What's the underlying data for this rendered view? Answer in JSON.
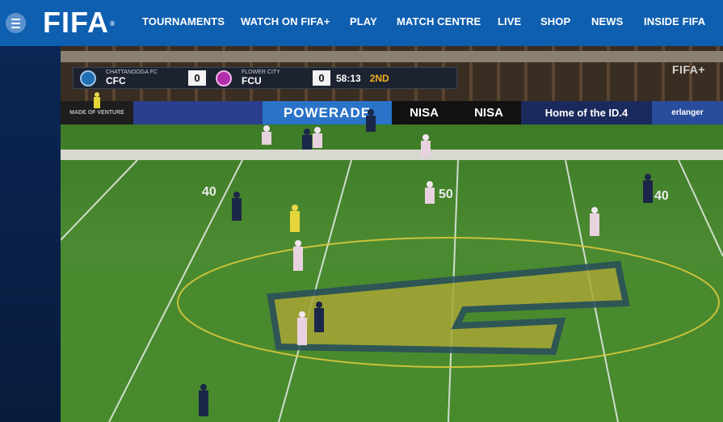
{
  "header": {
    "logo": "FIFA",
    "logo_mark": "®",
    "nav": [
      {
        "label": "TOURNAMENTS"
      },
      {
        "label": "WATCH ON FIFA+"
      },
      {
        "label": "PLAY"
      },
      {
        "label": "MATCH CENTRE"
      },
      {
        "label": "LIVE"
      },
      {
        "label": "SHOP"
      },
      {
        "label": "NEWS"
      },
      {
        "label": "INSIDE FIFA"
      }
    ]
  },
  "video": {
    "watermark": "FIFA+",
    "scorebug": {
      "home_full": "CHATTANOOGA FC",
      "home_abbr": "CFC",
      "home_score": "0",
      "away_full": "FLOWER CITY",
      "away_abbr": "FCU",
      "away_score": "0",
      "clock": "58:13",
      "period": "2ND"
    },
    "ads": [
      {
        "text": "MADE OF VENTURE"
      },
      {
        "text": "POWERADE"
      },
      {
        "text": "NISA"
      },
      {
        "text": "NISA"
      },
      {
        "text": "Home of the ID.4"
      },
      {
        "text": "erlanger"
      }
    ],
    "field_numbers": [
      "40",
      "50",
      "40"
    ]
  },
  "colors": {
    "header_bg": "#0f5fb0",
    "home_badge": "#1f6fb3",
    "away_badge": "#b02ea8",
    "period": "#f0b020"
  }
}
